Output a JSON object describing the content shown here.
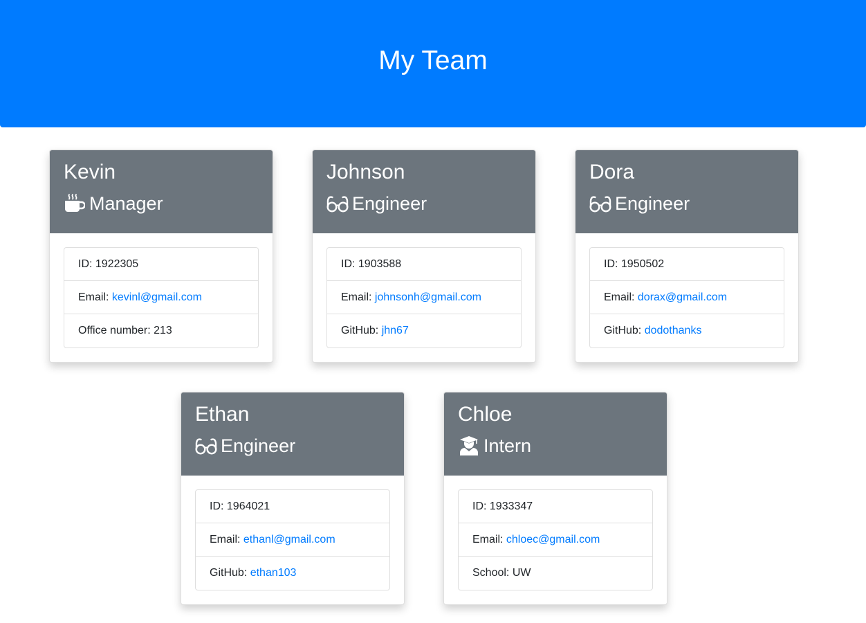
{
  "header": {
    "title": "My Team"
  },
  "colors": {
    "header_bg": "#007bff",
    "card_header_bg": "#6c757d",
    "link": "#007bff"
  },
  "members": [
    {
      "name": "Kevin",
      "role": "Manager",
      "role_icon": "mug-hot-icon",
      "id_label": "ID:",
      "id_value": "1922305",
      "email_label": "Email:",
      "email": "kevinl@gmail.com",
      "extra_label": "Office number:",
      "extra_value": "213"
    },
    {
      "name": "Johnson",
      "role": "Engineer",
      "role_icon": "glasses-icon",
      "id_label": "ID:",
      "id_value": "1903588",
      "email_label": "Email:",
      "email": "johnsonh@gmail.com",
      "extra_label": "GitHub:",
      "extra_value": "jhn67"
    },
    {
      "name": "Dora",
      "role": "Engineer",
      "role_icon": "glasses-icon",
      "id_label": "ID:",
      "id_value": "1950502",
      "email_label": "Email:",
      "email": "dorax@gmail.com",
      "extra_label": "GitHub:",
      "extra_value": "dodothanks"
    },
    {
      "name": "Ethan",
      "role": "Engineer",
      "role_icon": "glasses-icon",
      "id_label": "ID:",
      "id_value": "1964021",
      "email_label": "Email:",
      "email": "ethanl@gmail.com",
      "extra_label": "GitHub:",
      "extra_value": "ethan103"
    },
    {
      "name": "Chloe",
      "role": "Intern",
      "role_icon": "user-graduate-icon",
      "id_label": "ID:",
      "id_value": "1933347",
      "email_label": "Email:",
      "email": "chloec@gmail.com",
      "extra_label": "School:",
      "extra_value": "UW"
    }
  ]
}
